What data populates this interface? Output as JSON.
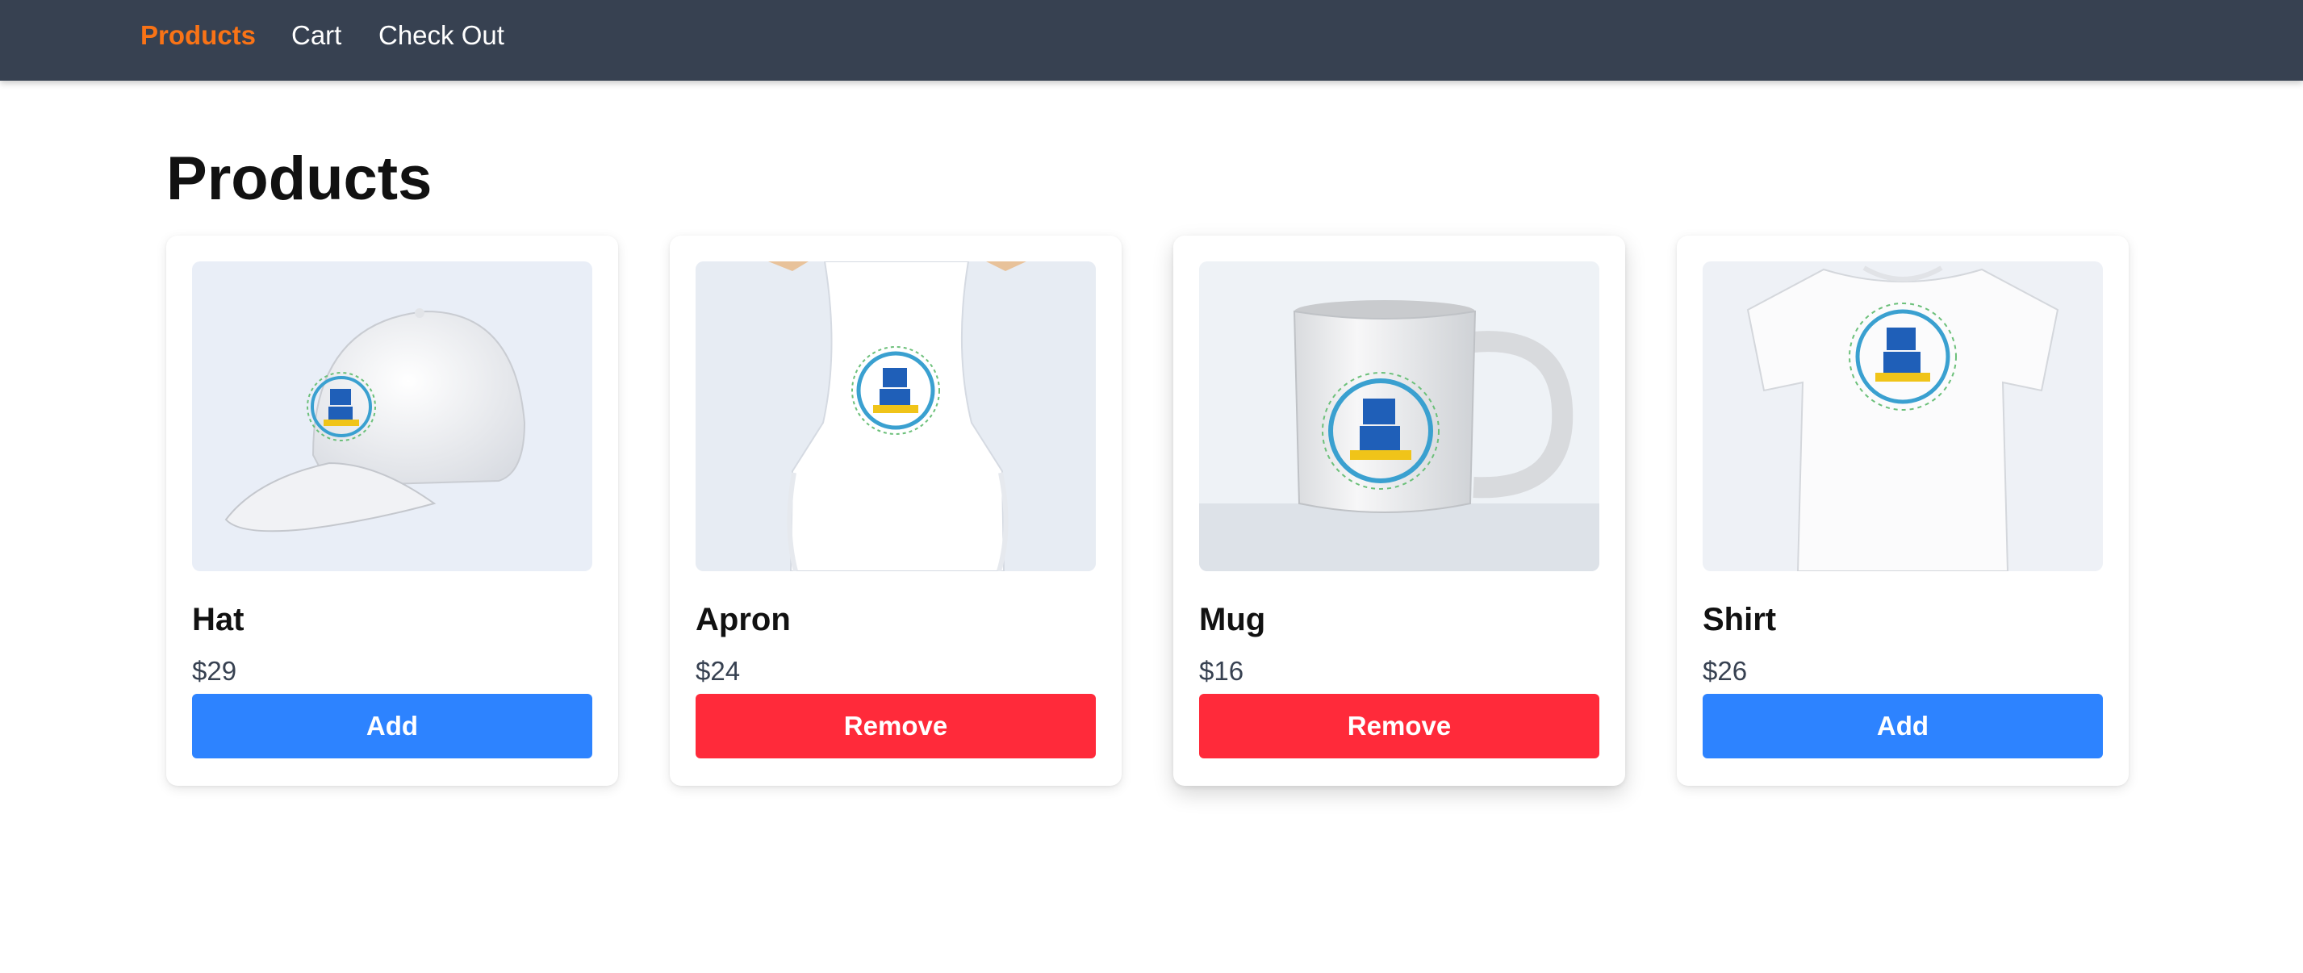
{
  "nav": {
    "items": [
      {
        "label": "Products",
        "active": true
      },
      {
        "label": "Cart",
        "active": false
      },
      {
        "label": "Check Out",
        "active": false
      }
    ]
  },
  "page": {
    "title": "Products"
  },
  "products": [
    {
      "name": "Hat",
      "price": "$29",
      "action": "Add",
      "image": "hat-image"
    },
    {
      "name": "Apron",
      "price": "$24",
      "action": "Remove",
      "image": "apron-image"
    },
    {
      "name": "Mug",
      "price": "$16",
      "action": "Remove",
      "image": "mug-image"
    },
    {
      "name": "Shirt",
      "price": "$26",
      "action": "Add",
      "image": "shirt-image"
    }
  ],
  "colors": {
    "nav_bg": "#374151",
    "nav_active": "#f97316",
    "add_button": "#2d83ff",
    "remove_button": "#ff2a3a"
  }
}
